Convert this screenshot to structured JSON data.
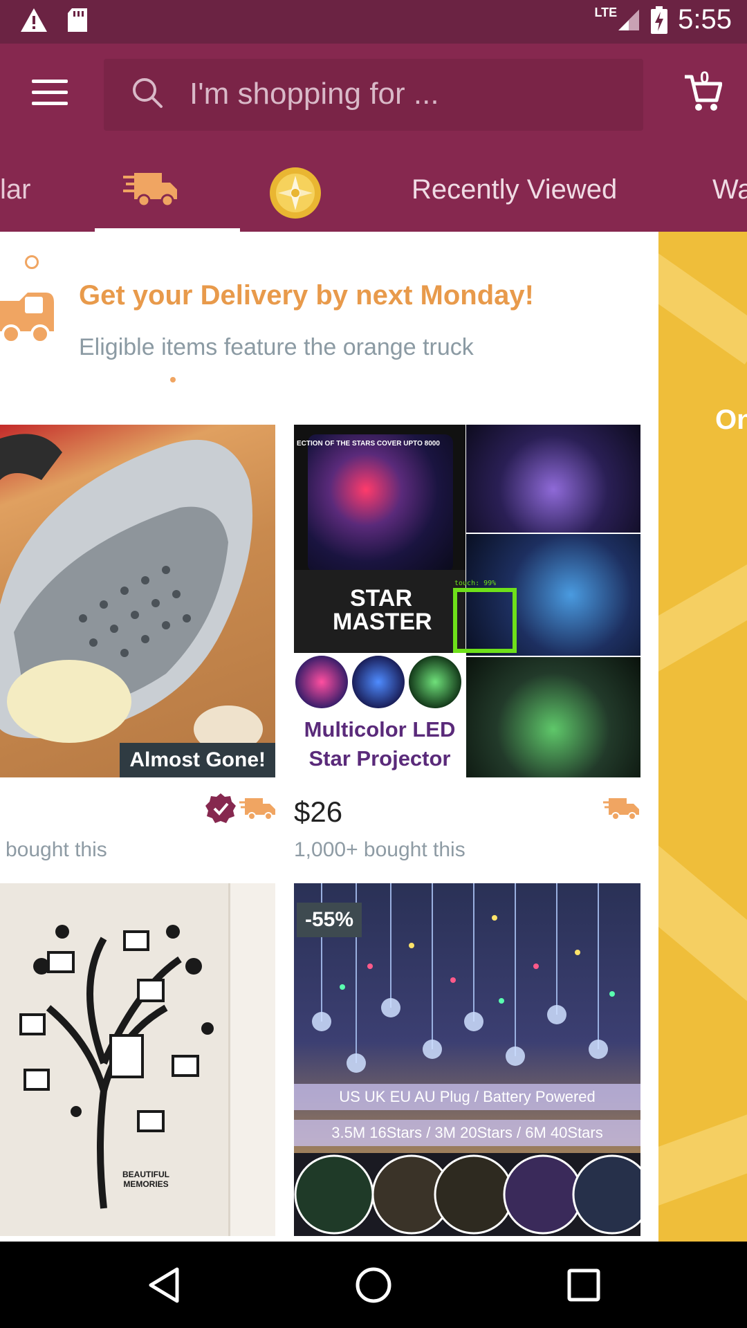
{
  "status_bar": {
    "time": "5:55",
    "network": "LTE",
    "icons": [
      "warning-icon",
      "sd-card-icon",
      "signal-icon",
      "battery-charging-icon"
    ]
  },
  "header": {
    "search_placeholder": "I'm shopping for ...",
    "cart_count": "0"
  },
  "tabs": [
    {
      "label": "lar",
      "type": "text"
    },
    {
      "label": "",
      "type": "truck-icon",
      "selected": true
    },
    {
      "label": "",
      "type": "coin-icon"
    },
    {
      "label": "Recently Viewed",
      "type": "text"
    },
    {
      "label": "Wa",
      "type": "text"
    }
  ],
  "side_panel": {
    "text": "On"
  },
  "banner": {
    "title": "Get your Delivery by next Monday!",
    "subtitle": "Eligible items feature the orange truck"
  },
  "products": [
    {
      "name": "garlic-press",
      "badge": "Almost Gone!",
      "price": "",
      "bought": "bought this",
      "verified": true,
      "fast_delivery": true
    },
    {
      "name": "star-projector",
      "image_text": {
        "banner": "ECTION OF THE STARS COVER UPTO 8000",
        "brand": "STAR MASTER",
        "caption_line1": "Multicolor LED",
        "caption_line2": "Star Projector"
      },
      "price": "$26",
      "bought": "1,000+ bought this",
      "fast_delivery": true
    },
    {
      "name": "tree-wall-decal",
      "image_text": {
        "caption": "BEAUTIFUL MEMORIES"
      }
    },
    {
      "name": "snowflake-lights",
      "badge": "-55%",
      "image_text": {
        "line1": "US UK EU AU Plug  /  Battery Powered",
        "line2": "3.5M 16Stars / 3M 20Stars / 6M 40Stars"
      }
    }
  ],
  "overlay": {
    "touch_label": "touch: 99%"
  },
  "colors": {
    "status_bar": "#6b2343",
    "header": "#86284f",
    "accent_orange": "#e89a4b",
    "side_yellow": "#efbe3a"
  },
  "nav": {
    "icons": [
      "back-icon",
      "home-icon",
      "recents-icon"
    ]
  }
}
